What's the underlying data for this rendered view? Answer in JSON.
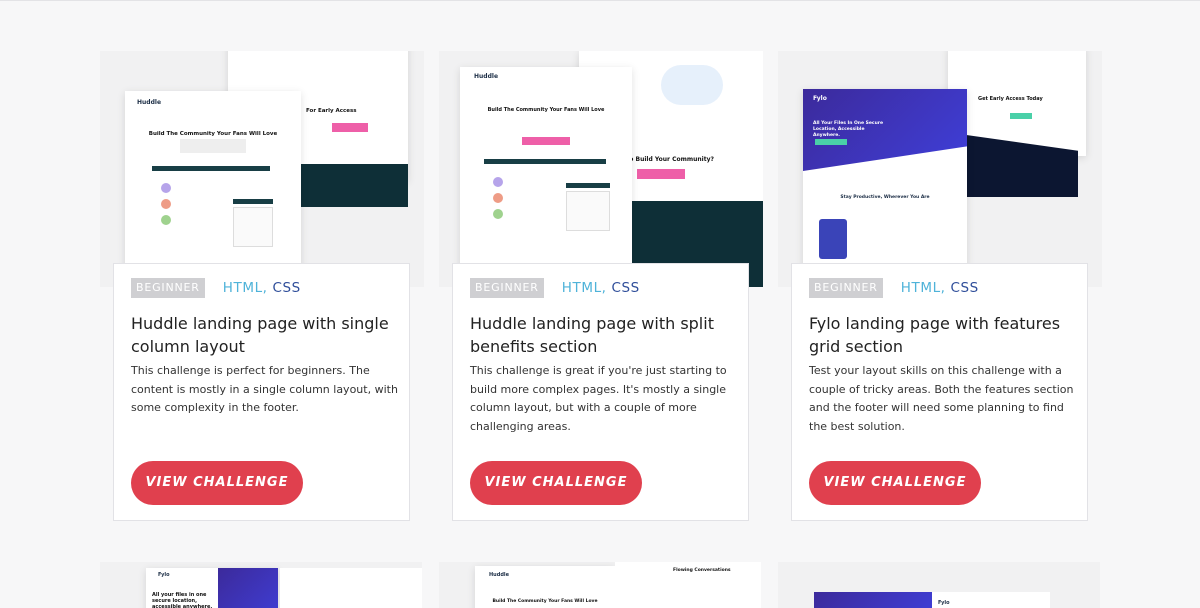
{
  "cards": [
    {
      "level": "BEGINNER",
      "lang_html": "HTML,",
      "lang_css": "CSS",
      "title": "Huddle landing page with single column layout",
      "description": "This challenge is perfect for beginners. The content is mostly in a single column layout, with some complexity in the footer.",
      "button": "VIEW CHALLENGE",
      "preview": {
        "brand": "Huddle",
        "headline": "Build The Community Your Fans Will Love",
        "side_text": "For Early Access"
      }
    },
    {
      "level": "BEGINNER",
      "lang_html": "HTML,",
      "lang_css": "CSS",
      "title": "Huddle landing page with split benefits section",
      "description": "This challenge is great if you're just starting to build more complex pages. It's mostly a single column layout, but with a couple of more challenging areas.",
      "button": "VIEW CHALLENGE",
      "preview": {
        "brand": "Huddle",
        "headline": "Build The Community Your Fans Will Love",
        "side_text": "y To Build Your Community?"
      }
    },
    {
      "level": "BEGINNER",
      "lang_html": "HTML,",
      "lang_css": "CSS",
      "title": "Fylo landing page with features grid section",
      "description": "Test your layout skills on this challenge with a couple of tricky areas. Both the features section and the footer will need some planning to find the best solution.",
      "button": "VIEW CHALLENGE",
      "preview": {
        "brand": "Fylo",
        "headline": "All Your Files In One Secure Location, Accessible Anywhere.",
        "side_text": "Get Early Access Today",
        "section": "Stay Productive, Wherever You Are"
      }
    }
  ],
  "second_row": [
    {
      "brand": "Fylo",
      "headline": "All your files in one secure location, accessible anywhere."
    },
    {
      "brand": "Huddle",
      "headline": "Build The Community Your Fans Will Love",
      "side_text": "Flowing Conversations"
    },
    {
      "brand": "Fylo"
    }
  ],
  "colors": {
    "accent": "#e0404e",
    "html": "#4fb3d9",
    "css": "#2f4e9a",
    "badge": "#cfcfd2"
  }
}
